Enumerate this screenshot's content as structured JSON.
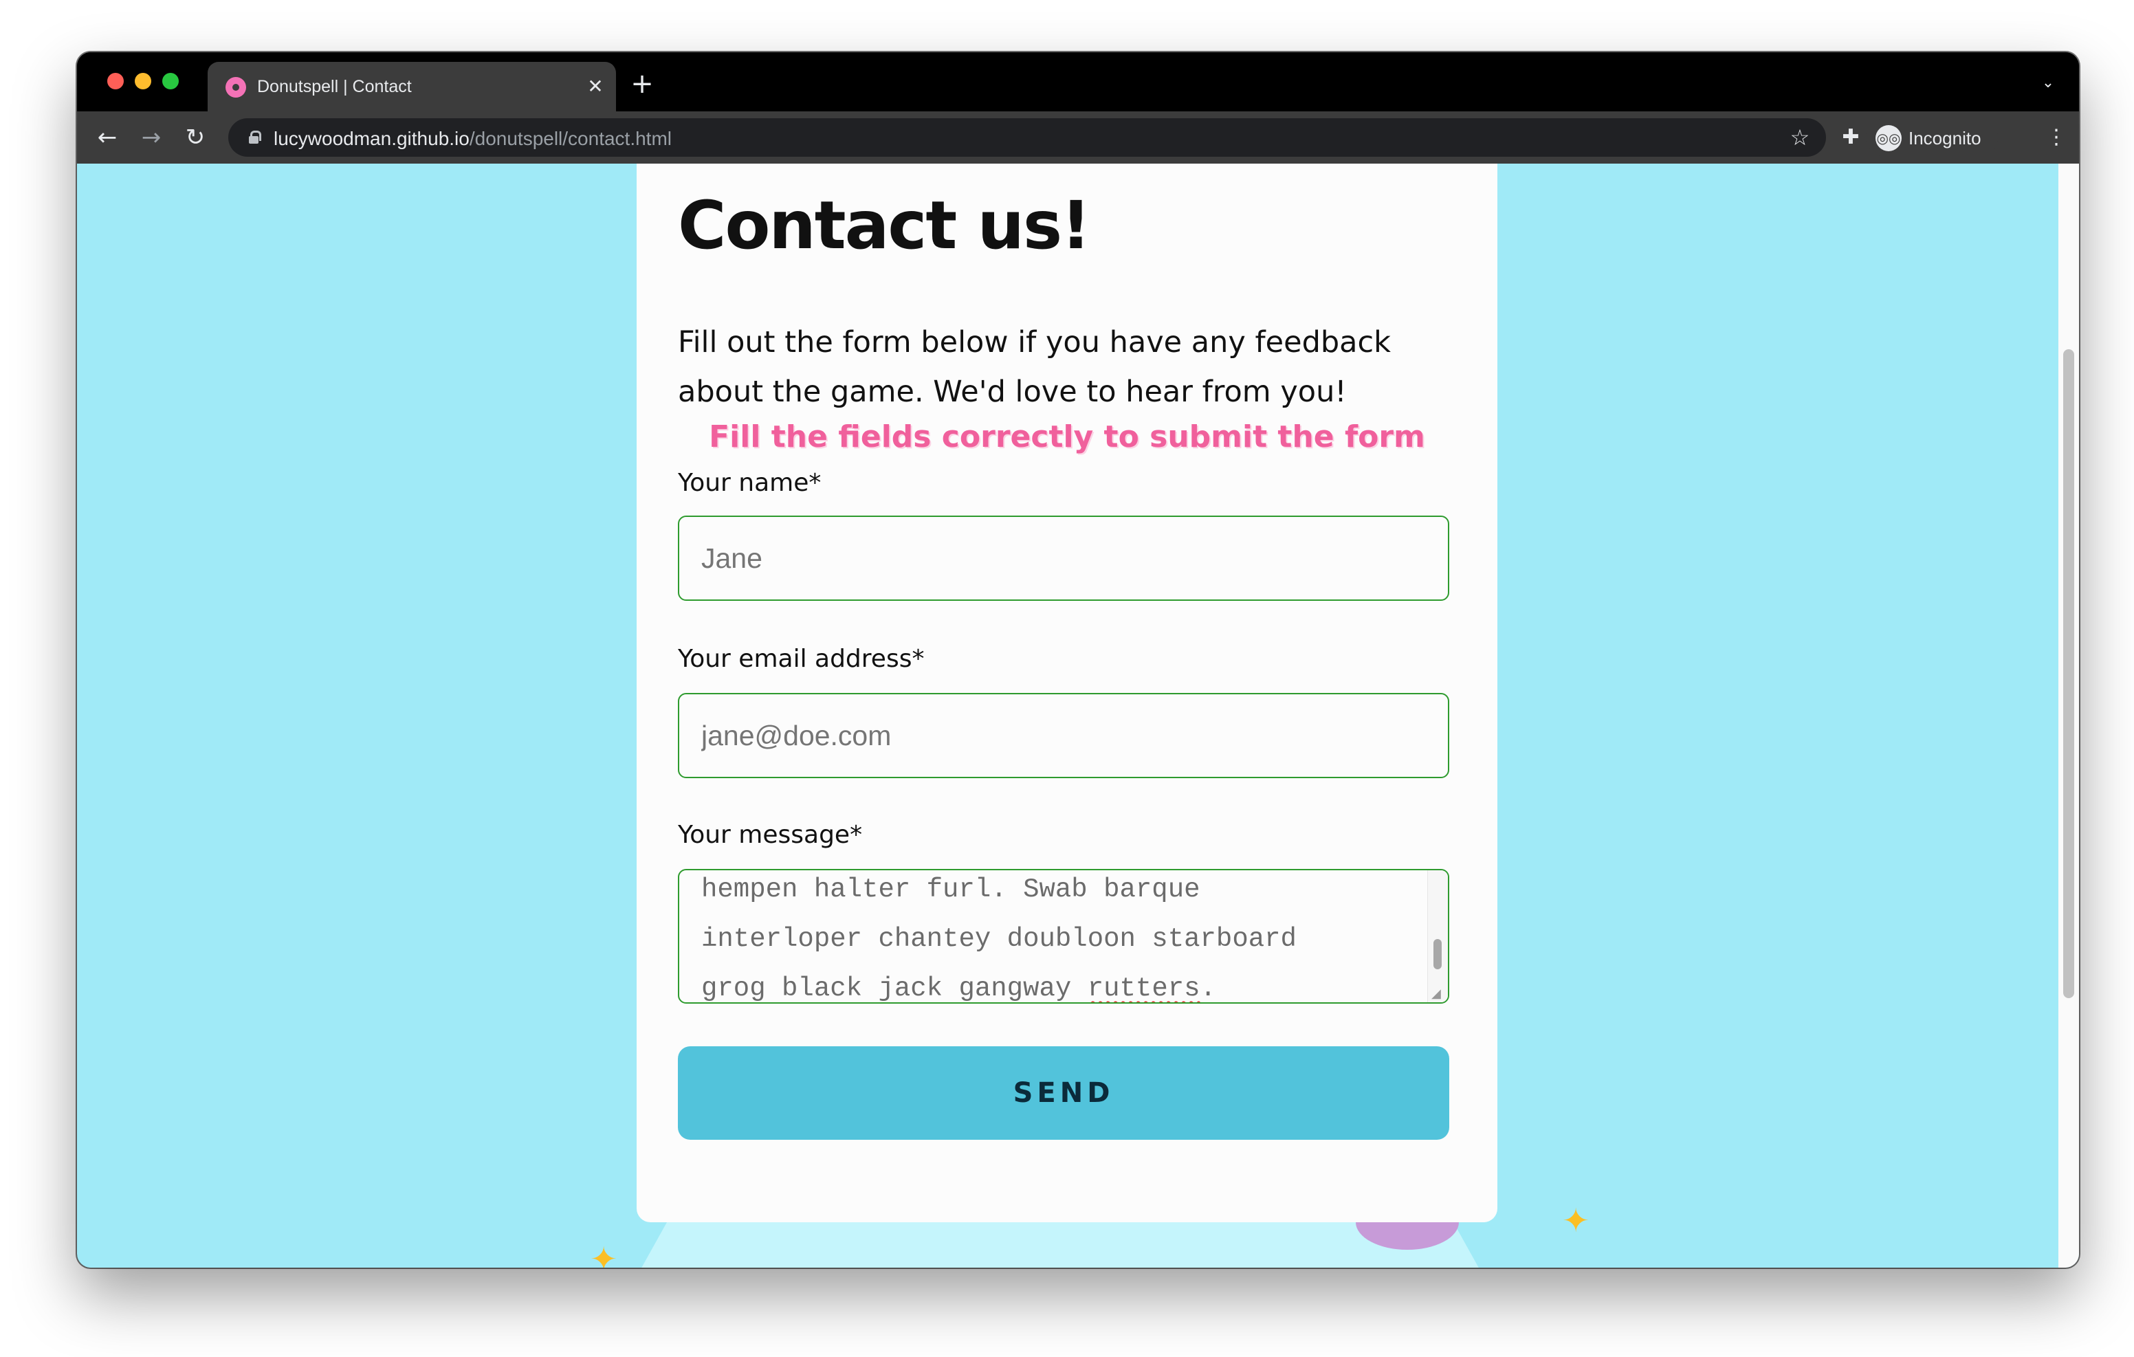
{
  "browser": {
    "tab": {
      "title": "Donutspell | Contact",
      "close_glyph": "✕"
    },
    "new_tab_glyph": "+",
    "tab_menu_glyph": "⌄",
    "nav": {
      "back_glyph": "←",
      "forward_glyph": "→",
      "reload_glyph": "↻"
    },
    "url": {
      "host": "lucywoodman.github.io",
      "path": "/donutspell/contact.html"
    },
    "star_glyph": "☆",
    "extensions_glyph": "✚",
    "incognito": {
      "label": "Incognito",
      "icon_glyph": "◎◎"
    },
    "kebab_glyph": "⋮"
  },
  "page": {
    "heading": "Contact us!",
    "intro": "Fill out the form below if you have any feedback about the game. We'd love to hear from you!",
    "error": "Fill the fields correctly to submit the form",
    "form": {
      "name_label": "Your name*",
      "name_placeholder": "Jane",
      "email_label": "Your email address*",
      "email_placeholder": "jane@doe.com",
      "message_label": "Your message*",
      "message_lines": [
        "hempen halter furl. Swab barque",
        "interloper chantey doubloon starboard",
        "grog black jack gangway "
      ],
      "message_misspelled": "rutters",
      "message_end": ".",
      "submit_label": "SEND"
    }
  },
  "colors": {
    "page_bg": "#a0eaf7",
    "card_bg": "#fcfcfc",
    "field_border": "#2e9b2e",
    "error_text": "#f0609c",
    "button_bg": "#52c3db",
    "sparkle": "#fbbf24",
    "blob": "#c79bd8"
  }
}
